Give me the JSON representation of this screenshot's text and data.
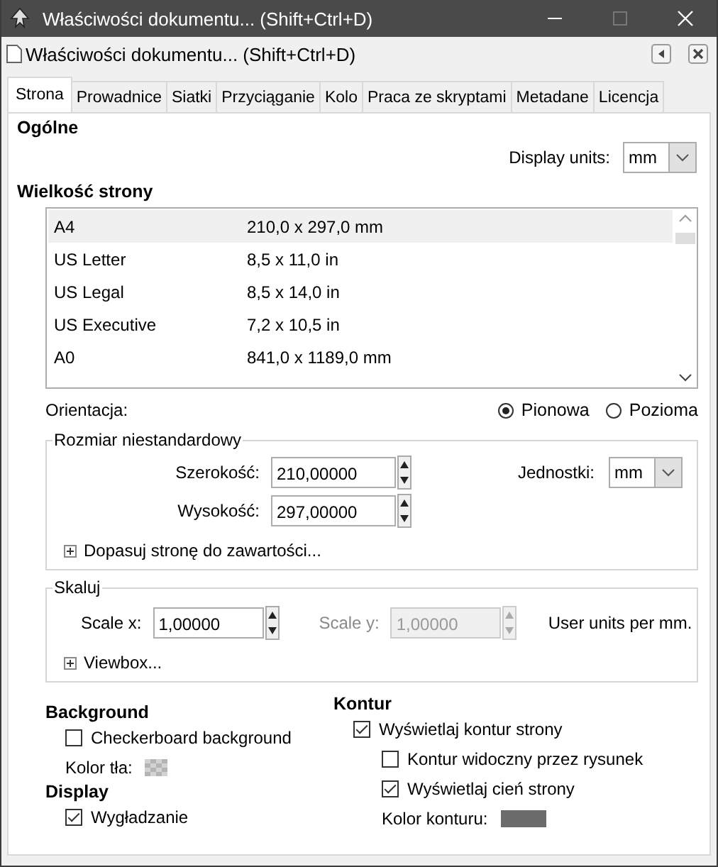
{
  "window": {
    "title": "Właściwości dokumentu... (Shift+Ctrl+D)"
  },
  "dock_header": {
    "title": "Właściwości dokumentu... (Shift+Ctrl+D)"
  },
  "tabs": [
    {
      "label": "Strona",
      "selected": true
    },
    {
      "label": "Prowadnice",
      "selected": false
    },
    {
      "label": "Siatki",
      "selected": false
    },
    {
      "label": "Przyciąganie",
      "selected": false
    },
    {
      "label": "Kolo",
      "selected": false
    },
    {
      "label": "Praca ze skryptami",
      "selected": false
    },
    {
      "label": "Metadane",
      "selected": false
    },
    {
      "label": "Licencja",
      "selected": false
    }
  ],
  "general": {
    "heading": "Ogólne",
    "display_units_label": "Display units:",
    "display_units_value": "mm"
  },
  "page_size": {
    "heading": "Wielkość strony",
    "rows": [
      {
        "name": "A4",
        "size": "210,0 x 297,0 mm",
        "selected": true
      },
      {
        "name": "US Letter",
        "size": "8,5 x 11,0 in",
        "selected": false
      },
      {
        "name": "US Legal",
        "size": "8,5 x 14,0 in",
        "selected": false
      },
      {
        "name": "US Executive",
        "size": "7,2 x 10,5 in",
        "selected": false
      },
      {
        "name": "A0",
        "size": "841,0 x 1189,0 mm",
        "selected": false
      }
    ]
  },
  "orientation": {
    "label": "Orientacja:",
    "options": [
      {
        "label": "Pionowa",
        "selected": true
      },
      {
        "label": "Pozioma",
        "selected": false
      }
    ]
  },
  "custom_size": {
    "legend": "Rozmiar niestandardowy",
    "width_label": "Szerokość:",
    "width_value": "210,00000",
    "height_label": "Wysokość:",
    "height_value": "297,00000",
    "units_label": "Jednostki:",
    "units_value": "mm",
    "expander": "Dopasuj stronę do zawartości..."
  },
  "scale": {
    "legend": "Skaluj",
    "scale_x_label": "Scale x:",
    "scale_x_value": "1,00000",
    "scale_y_label": "Scale y:",
    "scale_y_value": "1,00000",
    "scale_y_disabled": true,
    "units_note": "User units per mm.",
    "expander": "Viewbox..."
  },
  "background": {
    "heading": "Background",
    "checkerboard": {
      "label": "Checkerboard background",
      "checked": false
    },
    "color_label": "Kolor tła:"
  },
  "display": {
    "heading": "Display",
    "antialiasing": {
      "label": "Wygładzanie",
      "checked": true
    }
  },
  "border": {
    "heading": "Kontur",
    "show": {
      "label": "Wyświetlaj kontur strony",
      "checked": true,
      "children": [
        {
          "label": "Kontur widoczny przez rysunek",
          "checked": false
        },
        {
          "label": "Wyświetlaj cień strony",
          "checked": true
        }
      ]
    },
    "color_label": "Kolor konturu:"
  }
}
